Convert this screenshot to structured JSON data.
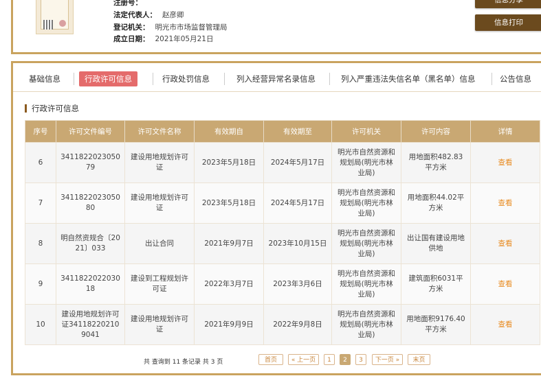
{
  "company": {
    "fields": [
      {
        "key": "注册号：",
        "value": ""
      },
      {
        "key": "法定代表人：",
        "value": "赵彦卿"
      },
      {
        "key": "登记机关：",
        "value": "明光市市场监督管理局"
      },
      {
        "key": "成立日期：",
        "value": "2021年05月21日"
      }
    ],
    "buttons": {
      "share": "信息分享",
      "print": "信息打印"
    }
  },
  "tabs": [
    {
      "label": "基础信息",
      "active": false
    },
    {
      "label": "行政许可信息",
      "active": true
    },
    {
      "label": "行政处罚信息",
      "active": false
    },
    {
      "label": "列入经营异常名录信息",
      "active": false
    },
    {
      "label": "列入严重违法失信名单（黑名单）信息",
      "active": false
    },
    {
      "label": "公告信息",
      "active": false
    }
  ],
  "section_title": "行政许可信息",
  "table": {
    "headers": [
      "序号",
      "许可文件编号",
      "许可文件名称",
      "有效期自",
      "有效期至",
      "许可机关",
      "许可内容",
      "详情"
    ],
    "rows": [
      [
        "6",
        "341182202305079",
        "建设用地规划许可证",
        "2023年5月18日",
        "2024年5月17日",
        "明光市自然资源和规划局(明光市林业局)",
        "用地面积482.83平方米",
        "查看"
      ],
      [
        "7",
        "341182202305080",
        "建设用地规划许可证",
        "2023年5月18日",
        "2024年5月17日",
        "明光市自然资源和规划局(明光市林业局)",
        "用地面积44.02平方米",
        "查看"
      ],
      [
        "8",
        "明自然资规合〔2021〕033",
        "出让合同",
        "2021年9月7日",
        "2023年10月15日",
        "明光市自然资源和规划局(明光市林业局)",
        "出让国有建设用地供地",
        "查看"
      ],
      [
        "9",
        "341182202203018",
        "建设到工程规划许可证",
        "2022年3月7日",
        "2023年3月6日",
        "明光市自然资源和规划局(明光市林业局)",
        "建筑面积6031平方米",
        "查看"
      ],
      [
        "10",
        "建设用地规划许可证341182202109041",
        "建设用地规划许可证",
        "2021年9月9日",
        "2022年9月8日",
        "明光市自然资源和规划局(明光市林业局)",
        "用地面积9176.40平方米",
        "查看"
      ]
    ]
  },
  "pagination": {
    "total_text": "共 查询到 11 条记录 共 3 页",
    "first": "首页",
    "prev": "« 上一页",
    "pages": [
      "1",
      "2",
      "3"
    ],
    "current": "2",
    "next": "下一页 »",
    "last": "末页"
  },
  "colors": {
    "accent": "#c9a35e",
    "header": "#c9a873",
    "active_tab": "#e46b6b",
    "button": "#6b4a1e",
    "link": "#e88a1e"
  }
}
